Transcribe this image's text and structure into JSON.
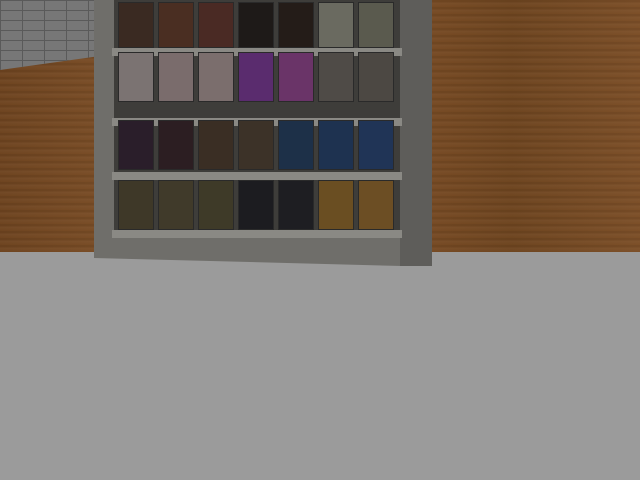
{
  "scene": {
    "name": "bookstore-room",
    "colors": {
      "floor": "#9b9b9b",
      "wood": "#74492a",
      "brick": "#777777",
      "shelf_frame": "#6f6e6a"
    }
  },
  "books": {
    "row1": [
      {
        "color": "#3a2a22"
      },
      {
        "color": "#4a2e22"
      },
      {
        "color": "#4a2a24"
      },
      {
        "color": "#1e1a18"
      },
      {
        "color": "#241c18"
      },
      {
        "color": "#6a6a60"
      },
      {
        "color": "#5a5a4e"
      }
    ],
    "row2": [
      {
        "color": "#7b7372"
      },
      {
        "color": "#7a6c6c"
      },
      {
        "color": "#7b6e6d"
      },
      {
        "color": "#5a2c6e"
      },
      {
        "color": "#6a3468"
      },
      {
        "color": "#4f4b47"
      },
      {
        "color": "#4c4843"
      }
    ],
    "row3": [
      {
        "color": "#2a1e2a"
      },
      {
        "color": "#2c1e22"
      },
      {
        "color": "#3a2e24"
      },
      {
        "color": "#3c3228"
      },
      {
        "color": "#1d3048"
      },
      {
        "color": "#1e3250"
      },
      {
        "color": "#203456"
      }
    ],
    "row4": [
      {
        "color": "#3e3828"
      },
      {
        "color": "#403a2a"
      },
      {
        "color": "#3e3a28"
      },
      {
        "color": "#1c1c20"
      },
      {
        "color": "#1e1e22"
      },
      {
        "color": "#6a4e22"
      },
      {
        "color": "#6c4e24"
      }
    ]
  }
}
